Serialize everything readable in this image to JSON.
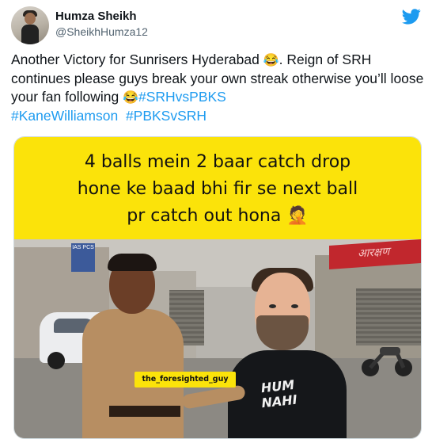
{
  "tweet": {
    "author": {
      "name": "Humza Sheikh",
      "handle": "@SheikhHumza12"
    },
    "text": {
      "part1": "Another Victory for Sunrisers Hyderabad ",
      "emoji1": "😂",
      "part2": ". Reign of SRH continues please guys break your own streak otherwise you’ll loose your fan following  ",
      "emoji2": "😂",
      "hashtags": [
        "#SRHvsPBKS",
        "#KaneWilliamson",
        "#PBKSvSRH"
      ]
    },
    "media": {
      "caption_lines": [
        "4 balls mein 2 baar catch drop",
        "hone ke baad bhi fir se next ball",
        "pr catch out hona"
      ],
      "caption_emoji": "🤦",
      "watermark": "the_foresighted_guy",
      "shirt_lines": [
        "HUM",
        "NAHI"
      ]
    }
  },
  "colors": {
    "accent": "#1d9bf0",
    "caption_bg": "#fbe30a",
    "text": "#0f1419",
    "secondary": "#536471"
  },
  "icons": [
    "avatar",
    "twitter-bird-icon"
  ]
}
